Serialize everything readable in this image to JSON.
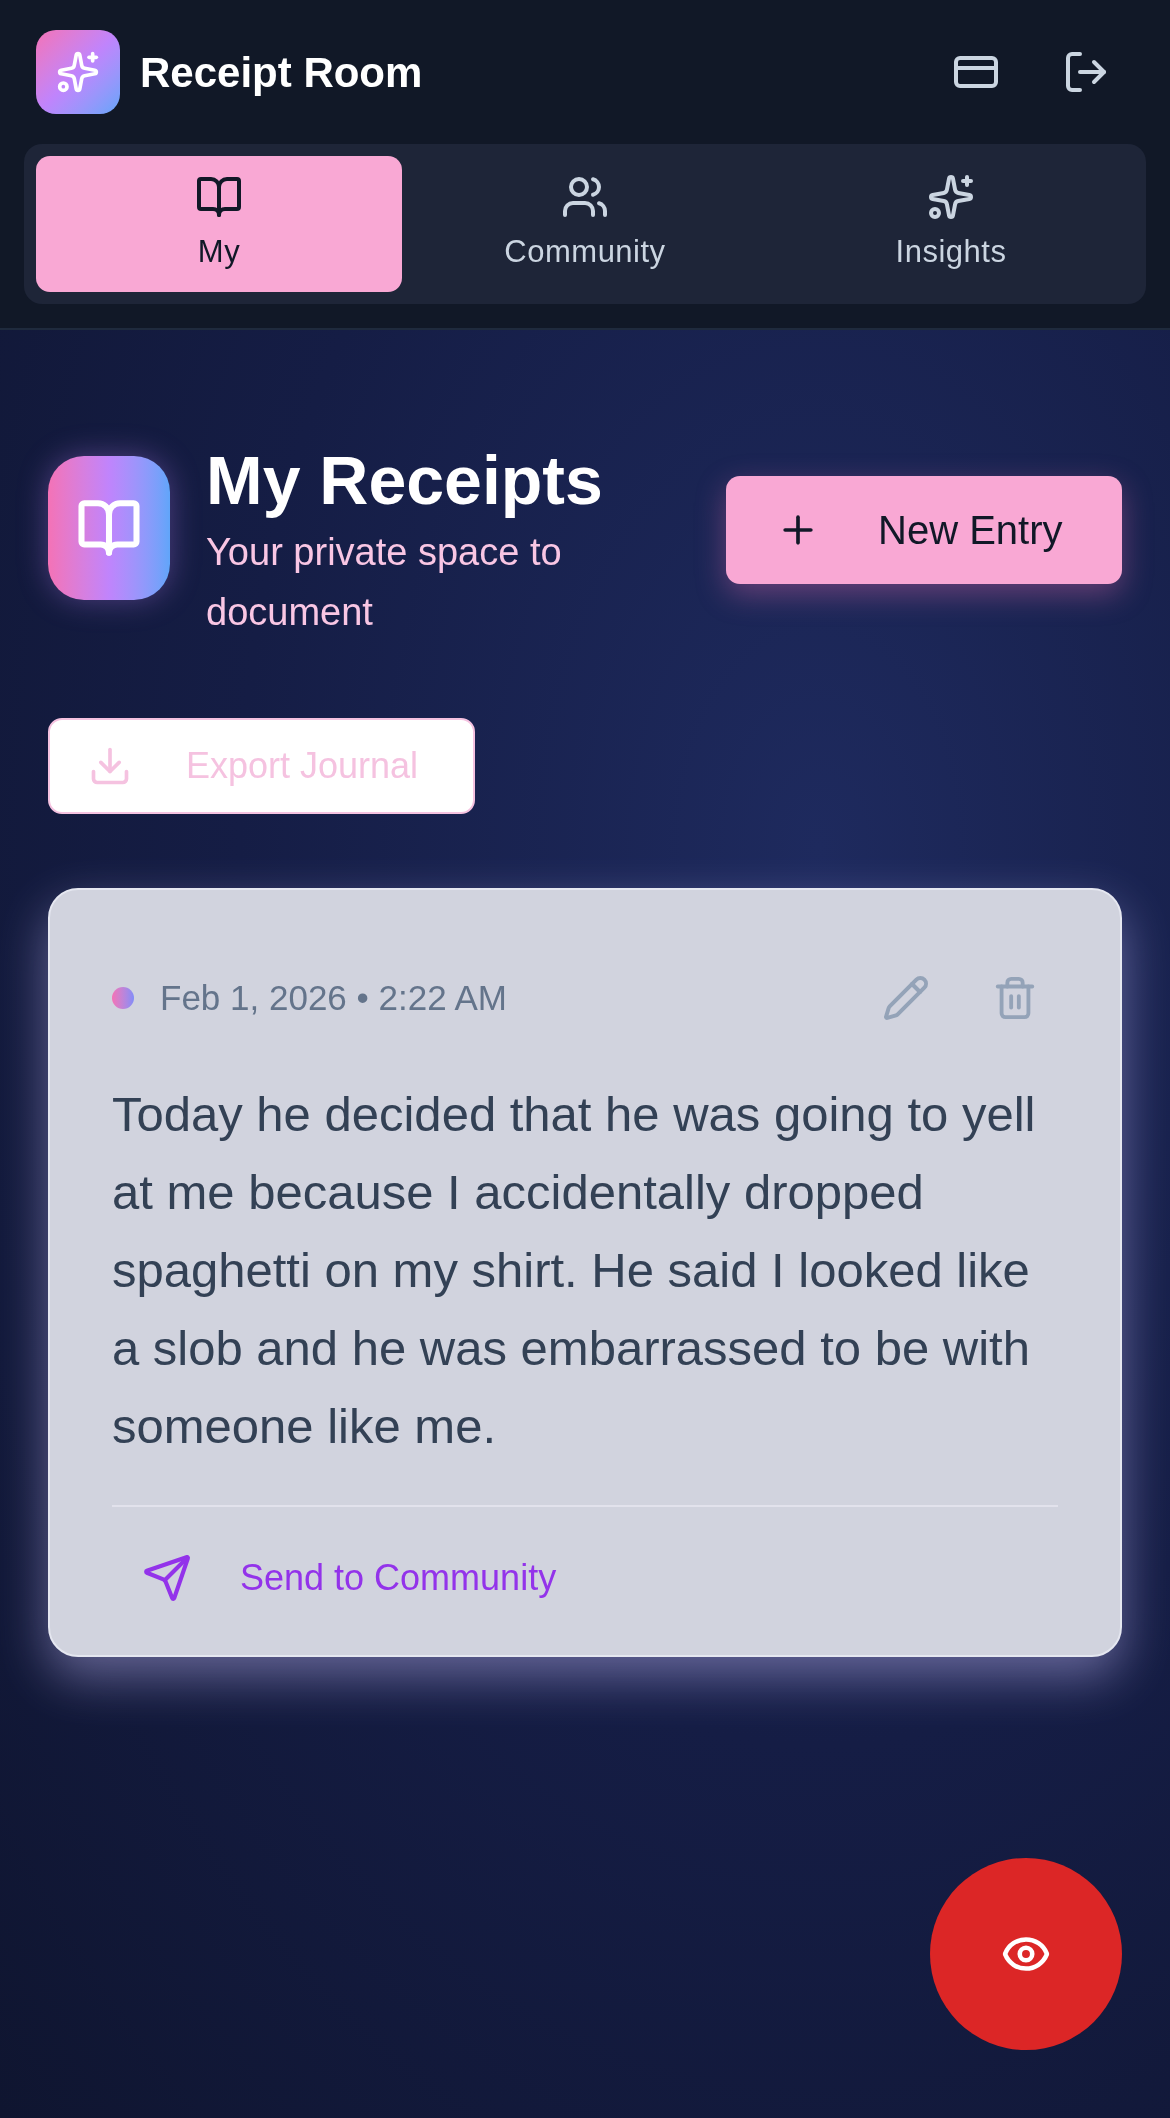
{
  "app": {
    "title": "Receipt Room"
  },
  "tabs": [
    {
      "label": "My",
      "selected": true
    },
    {
      "label": "Community",
      "selected": false
    },
    {
      "label": "Insights",
      "selected": false
    }
  ],
  "page": {
    "title": "My Receipts",
    "subtitle": "Your private space to document",
    "new_button": "New Entry",
    "export_button": {
      "label": "Export Journal",
      "disabled": true
    }
  },
  "entries": [
    {
      "date": "Feb 1, 2026 • 2:22 AM",
      "text": "Today he decided that he was going to yell at me because I accidentally dropped spaghetti on my shirt. He said I looked like a slob and he was embarrassed to be with someone like me.",
      "action": "Send to Community"
    }
  ]
}
